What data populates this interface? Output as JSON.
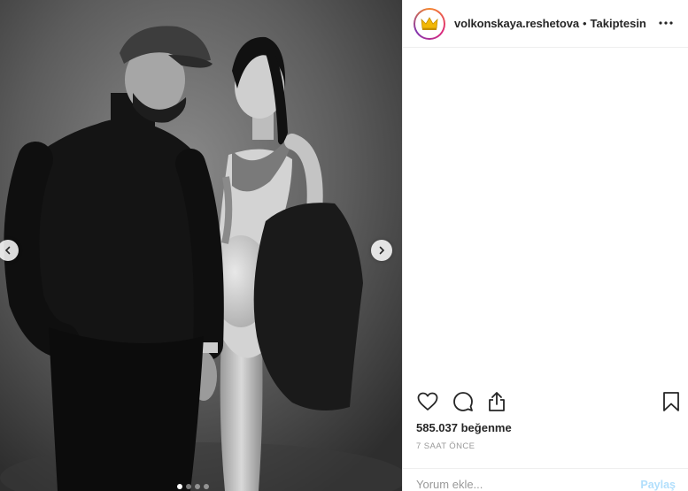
{
  "post": {
    "username": "volkonskaya.reshetova",
    "separator": "•",
    "follow_label": "Takiptesin",
    "likes_text": "585.037 beğenme",
    "time_text": "7 SAAT ÖNCE",
    "comment_placeholder": "Yorum ekle...",
    "post_label": "Paylaş"
  },
  "icons": {
    "avatar": "crown-icon",
    "more": "more-horizontal-icon",
    "like": "heart-icon",
    "comment": "comment-bubble-icon",
    "share": "share-icon",
    "save": "bookmark-icon",
    "prev": "chevron-left-icon",
    "next": "chevron-right-icon"
  },
  "colors": {
    "link_disabled": "#b2dffc",
    "meta_gray": "#999999",
    "text": "#262626",
    "crown_gold": "#f2b705"
  }
}
